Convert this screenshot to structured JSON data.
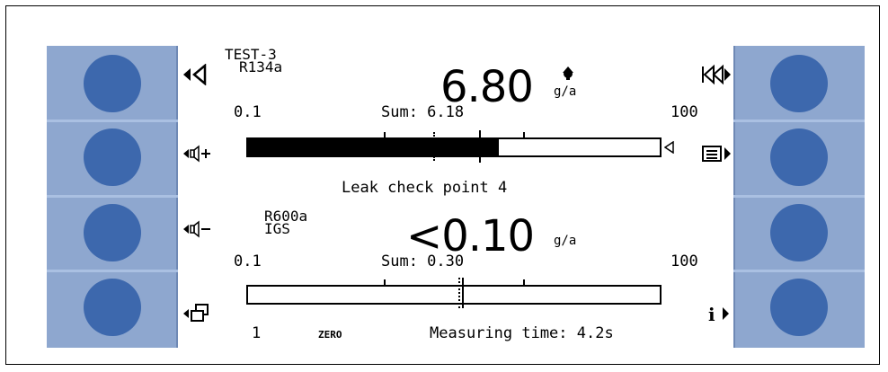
{
  "channel_top": {
    "test_name": "TEST-3",
    "gas": "R134a",
    "value": "6.80",
    "unit": "g/a",
    "scale_min": "0.1",
    "sum_label": "Sum: 6.18",
    "scale_max": "100",
    "bar_fill_fraction": 0.61,
    "bar_marker_fraction": 0.56,
    "bar_dotted_fraction": 0.45
  },
  "message": "Leak check point 4",
  "channel_bottom": {
    "gas": "R600a",
    "mode": "IGS",
    "value": "<0.10",
    "unit": "g/a",
    "scale_min": "0.1",
    "sum_label": "Sum: 0.30",
    "scale_max": "100",
    "bar_fill_fraction": 0.0,
    "bar_marker_fraction": 0.52,
    "bar_dotted_fraction": 0.51
  },
  "footer": {
    "left_value": "1",
    "zero_label": "ZERO",
    "measuring_time": "Measuring time: 4.2s"
  },
  "icons": {
    "left": [
      "back-arrow-icon",
      "volume-up-icon",
      "volume-down-icon",
      "window-icon"
    ],
    "right": [
      "rewind-icon",
      "menu-icon",
      "info-icon"
    ]
  },
  "colors": {
    "side_panel": "#8ea7cf",
    "soft_button": "#3d68ad"
  }
}
